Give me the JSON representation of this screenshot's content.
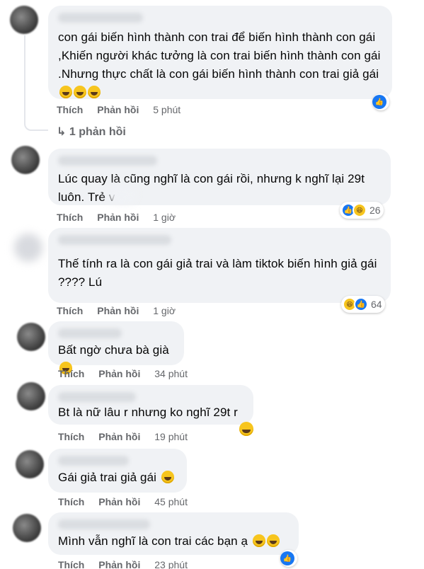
{
  "comments": [
    {
      "text": "con gái biến hình thành con trai để biến hình thành con gái ,Khiến người khác tưởng là con trai biến hình thành con gái .Nhưng thực chất là con gái biến hình thành con trai giả gái",
      "like": "Thích",
      "reply": "Phản hồi",
      "time": "5 phút",
      "reaction_count": ""
    },
    {
      "text": "Lúc quay là cũng nghĩ là con gái rồi, nhưng k nghĩ lại 29t luôn. Trẻ v",
      "like": "Thích",
      "reply": "Phản hồi",
      "time": "1 giờ",
      "reaction_count": "26"
    },
    {
      "text": "Thế tính ra là con gái giả trai và làm tiktok biến hình giả gái ???? Lú",
      "like": "Thích",
      "reply": "Phản hồi",
      "time": "1 giờ",
      "reaction_count": "64"
    },
    {
      "text": "Bất ngờ chưa bà già",
      "like": "Thích",
      "reply": "Phản hồi",
      "time": "34 phút",
      "reaction_count": ""
    },
    {
      "text": "Bt là nữ lâu r nhưng ko nghĩ 29t r",
      "like": "Thích",
      "reply": "Phản hồi",
      "time": "19 phút",
      "reaction_count": ""
    },
    {
      "text": "Gái giả trai giả gái",
      "like": "Thích",
      "reply": "Phản hồi",
      "time": "45 phút",
      "reaction_count": ""
    },
    {
      "text": "Mình vẫn nghĩ là con trai các bạn ạ",
      "like": "Thích",
      "reply": "Phản hồi",
      "time": "23 phút",
      "reaction_count": ""
    }
  ],
  "replies_link": "↳ 1 phản hồi",
  "icons": {
    "like": "like-icon",
    "haha": "haha-icon"
  },
  "colors": {
    "bubble": "#f0f2f5",
    "meta": "#65676b",
    "like_blue": "#1877f2",
    "haha_yellow": "#f7c51e"
  }
}
